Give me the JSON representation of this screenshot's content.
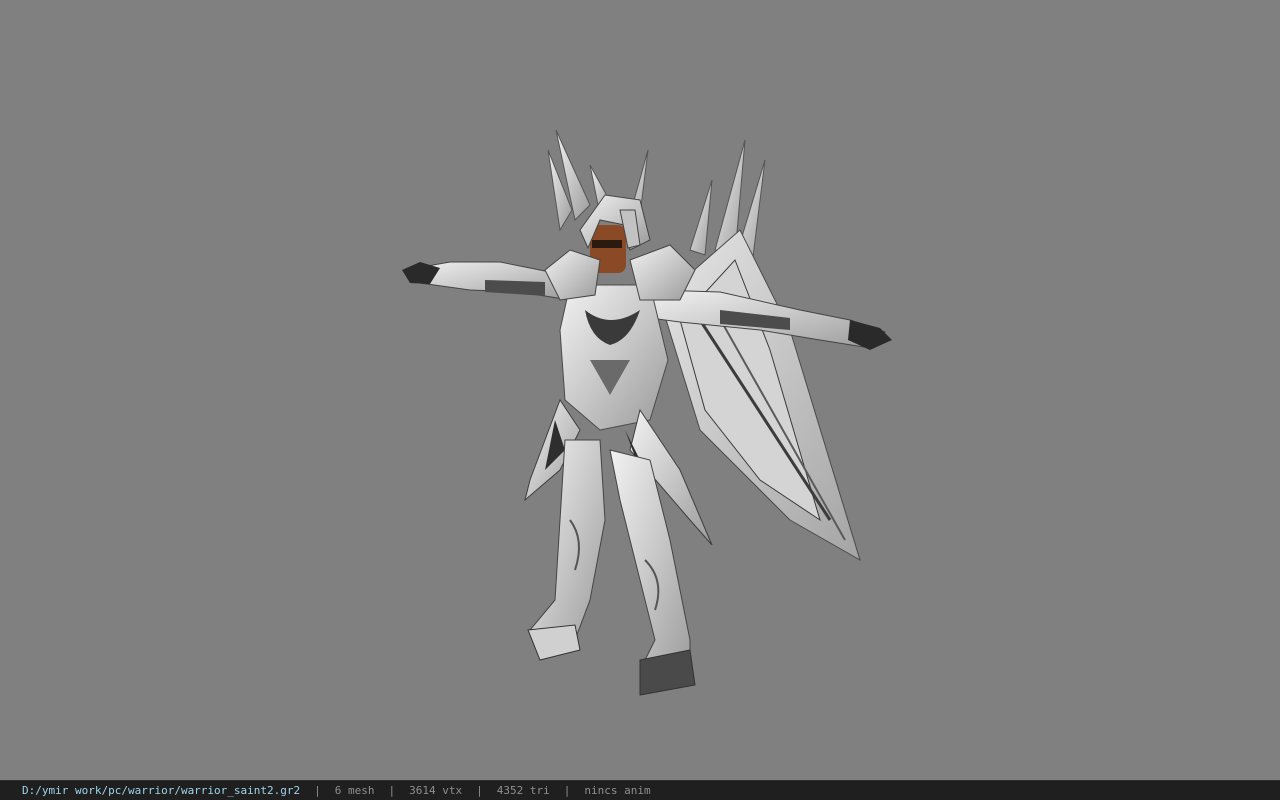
{
  "viewport": {
    "background_color": "#808080",
    "model_icon": "armored-warrior-model"
  },
  "status_bar": {
    "file_path": "D:/ymir work/pc/warrior/warrior_saint2.gr2",
    "mesh_count": "6 mesh",
    "vertex_count": "3614 vtx",
    "triangle_count": "4352 tri",
    "animation": "nincs anim",
    "separator": "|",
    "path_color": "#9ed3ea",
    "text_color": "#8f8f8f"
  }
}
